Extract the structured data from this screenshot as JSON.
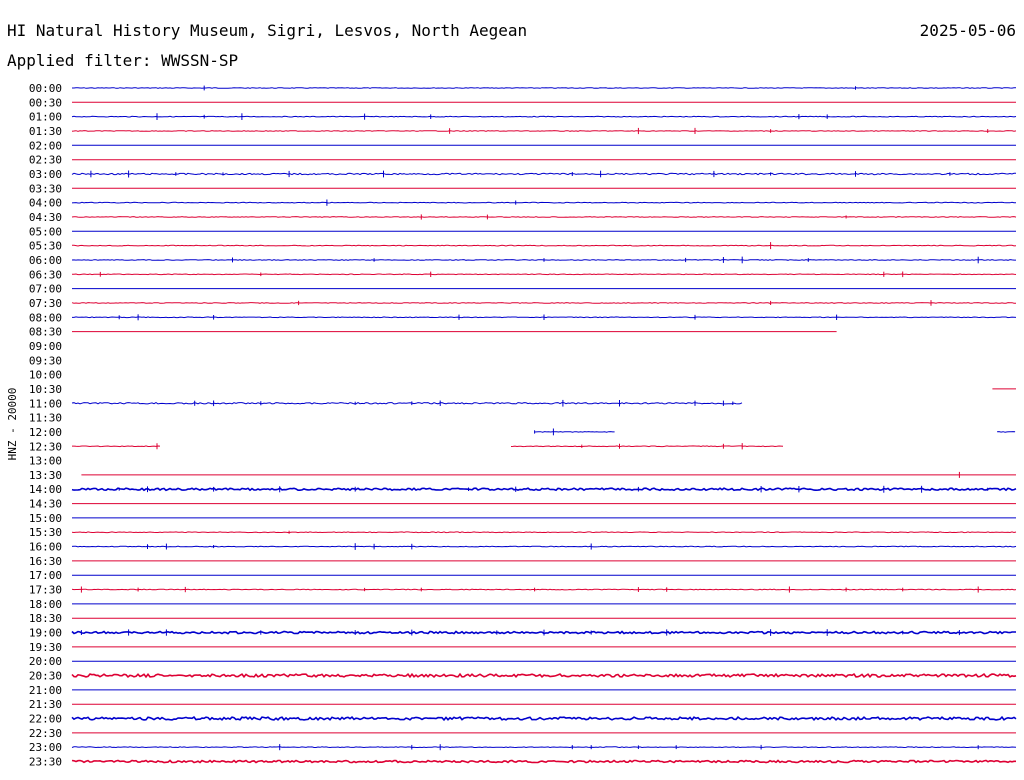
{
  "header": {
    "station": "HI Natural History Museum, Sigri, Lesvos, North Aegean",
    "date": "2025-05-06",
    "filter": "Applied filter: WWSSN-SP"
  },
  "colors": {
    "even_hour": "#0000cc",
    "half_hour": "#dd0033",
    "text": "#000000"
  },
  "chart_data": {
    "type": "line",
    "title": "HI Natural History Museum, Sigri, Lesvos, North Aegean",
    "subtitle": "Applied filter: WWSSN-SP",
    "ylabel": "HNZ - 20000",
    "xlim": [
      0,
      1
    ],
    "grid": false,
    "rows": [
      {
        "label": "00:00",
        "start": 0.0,
        "end": 1.0,
        "noise": 1,
        "spikes": [
          0.14,
          0.83
        ]
      },
      {
        "label": "00:30",
        "start": 0.0,
        "end": 1.0,
        "noise": 0,
        "spikes": []
      },
      {
        "label": "01:00",
        "start": 0.0,
        "end": 1.0,
        "noise": 1,
        "spikes": [
          0.09,
          0.14,
          0.18,
          0.31,
          0.38,
          0.77,
          0.8
        ]
      },
      {
        "label": "01:30",
        "start": 0.0,
        "end": 1.0,
        "noise": 1,
        "spikes": [
          0.4,
          0.6,
          0.66,
          0.74,
          0.97
        ]
      },
      {
        "label": "02:00",
        "start": 0.0,
        "end": 1.0,
        "noise": 0,
        "spikes": []
      },
      {
        "label": "02:30",
        "start": 0.0,
        "end": 1.0,
        "noise": 0,
        "spikes": []
      },
      {
        "label": "03:00",
        "start": 0.0,
        "end": 1.0,
        "noise": 2,
        "spikes": [
          0.02,
          0.06,
          0.11,
          0.16,
          0.23,
          0.33,
          0.53,
          0.56,
          0.68,
          0.74,
          0.83,
          0.93
        ]
      },
      {
        "label": "03:30",
        "start": 0.0,
        "end": 1.0,
        "noise": 0,
        "spikes": []
      },
      {
        "label": "04:00",
        "start": 0.0,
        "end": 1.0,
        "noise": 1,
        "spikes": [
          0.27,
          0.47
        ]
      },
      {
        "label": "04:30",
        "start": 0.0,
        "end": 1.0,
        "noise": 1,
        "spikes": [
          0.37,
          0.44,
          0.82
        ]
      },
      {
        "label": "05:00",
        "start": 0.0,
        "end": 1.0,
        "noise": 0,
        "spikes": []
      },
      {
        "label": "05:30",
        "start": 0.0,
        "end": 1.0,
        "noise": 1,
        "spikes": [
          0.74
        ]
      },
      {
        "label": "06:00",
        "start": 0.0,
        "end": 1.0,
        "noise": 1,
        "spikes": [
          0.17,
          0.32,
          0.5,
          0.65,
          0.69,
          0.71,
          0.78,
          0.96
        ]
      },
      {
        "label": "06:30",
        "start": 0.0,
        "end": 1.0,
        "noise": 1,
        "spikes": [
          0.03,
          0.2,
          0.38,
          0.86,
          0.88
        ]
      },
      {
        "label": "07:00",
        "start": 0.0,
        "end": 1.0,
        "noise": 0,
        "spikes": []
      },
      {
        "label": "07:30",
        "start": 0.0,
        "end": 1.0,
        "noise": 1,
        "spikes": [
          0.24,
          0.74,
          0.91
        ]
      },
      {
        "label": "08:00",
        "start": 0.0,
        "end": 1.0,
        "noise": 1,
        "spikes": [
          0.05,
          0.07,
          0.15,
          0.41,
          0.5,
          0.66,
          0.81
        ]
      },
      {
        "label": "08:30",
        "start": 0.0,
        "end": 0.81,
        "noise": 0,
        "spikes": []
      },
      {
        "label": "09:00",
        "segments": []
      },
      {
        "label": "09:30",
        "segments": []
      },
      {
        "label": "10:00",
        "segments": []
      },
      {
        "label": "10:30",
        "segments": [
          [
            0.975,
            1.0
          ]
        ],
        "noise": 0,
        "spikes": []
      },
      {
        "label": "11:00",
        "start": 0.0,
        "end": 0.71,
        "noise": 2,
        "spikes": [
          0.13,
          0.15,
          0.2,
          0.3,
          0.36,
          0.39,
          0.52,
          0.58,
          0.66,
          0.69,
          0.7
        ]
      },
      {
        "label": "11:30",
        "segments": []
      },
      {
        "label": "12:00",
        "segments": [
          [
            0.49,
            0.575
          ],
          [
            0.98,
            1.0
          ]
        ],
        "noise": 1,
        "spikes": [
          0.49,
          0.51
        ]
      },
      {
        "label": "12:30",
        "segments": [
          [
            0.0,
            0.095
          ],
          [
            0.465,
            0.755
          ]
        ],
        "noise": 1,
        "spikes": [
          0.09,
          0.54,
          0.58,
          0.69,
          0.71
        ]
      },
      {
        "label": "13:00",
        "segments": []
      },
      {
        "label": "13:30",
        "start": 0.01,
        "end": 1.0,
        "noise": 0,
        "spikes": [
          0.94
        ]
      },
      {
        "label": "14:00",
        "start": 0.0,
        "end": 1.0,
        "noise": 3,
        "spikes": [
          0.05,
          0.08,
          0.15,
          0.22,
          0.3,
          0.42,
          0.47,
          0.6,
          0.73,
          0.77,
          0.86,
          0.9,
          0.97
        ]
      },
      {
        "label": "14:30",
        "start": 0.0,
        "end": 1.0,
        "noise": 0,
        "spikes": []
      },
      {
        "label": "15:00",
        "start": 0.0,
        "end": 1.0,
        "noise": 0,
        "spikes": []
      },
      {
        "label": "15:30",
        "start": 0.0,
        "end": 1.0,
        "noise": 1,
        "spikes": [
          0.23
        ]
      },
      {
        "label": "16:00",
        "start": 0.0,
        "end": 1.0,
        "noise": 1,
        "spikes": [
          0.08,
          0.1,
          0.15,
          0.3,
          0.32,
          0.36,
          0.55
        ]
      },
      {
        "label": "16:30",
        "start": 0.0,
        "end": 1.0,
        "noise": 0,
        "spikes": []
      },
      {
        "label": "17:00",
        "start": 0.0,
        "end": 1.0,
        "noise": 0,
        "spikes": []
      },
      {
        "label": "17:30",
        "start": 0.0,
        "end": 1.0,
        "noise": 1,
        "spikes": [
          0.01,
          0.07,
          0.12,
          0.31,
          0.37,
          0.49,
          0.6,
          0.63,
          0.76,
          0.82,
          0.88,
          0.96
        ]
      },
      {
        "label": "18:00",
        "start": 0.0,
        "end": 1.0,
        "noise": 0,
        "spikes": []
      },
      {
        "label": "18:30",
        "start": 0.0,
        "end": 1.0,
        "noise": 0,
        "spikes": []
      },
      {
        "label": "19:00",
        "start": 0.0,
        "end": 1.0,
        "noise": 3,
        "spikes": [
          0.01,
          0.06,
          0.1,
          0.2,
          0.3,
          0.36,
          0.45,
          0.5,
          0.55,
          0.63,
          0.74,
          0.8,
          0.88,
          0.94
        ]
      },
      {
        "label": "19:30",
        "start": 0.0,
        "end": 1.0,
        "noise": 0,
        "spikes": []
      },
      {
        "label": "20:00",
        "start": 0.0,
        "end": 1.0,
        "noise": 0,
        "spikes": []
      },
      {
        "label": "20:30",
        "start": 0.0,
        "end": 1.0,
        "noise": 4,
        "spikes": []
      },
      {
        "label": "21:00",
        "start": 0.0,
        "end": 1.0,
        "noise": 0,
        "spikes": []
      },
      {
        "label": "21:30",
        "start": 0.0,
        "end": 1.0,
        "noise": 0,
        "spikes": []
      },
      {
        "label": "22:00",
        "start": 0.0,
        "end": 1.0,
        "noise": 4,
        "spikes": []
      },
      {
        "label": "22:30",
        "start": 0.0,
        "end": 1.0,
        "noise": 0,
        "spikes": []
      },
      {
        "label": "23:00",
        "start": 0.0,
        "end": 1.0,
        "noise": 1,
        "spikes": [
          0.22,
          0.36,
          0.39,
          0.53,
          0.55,
          0.6,
          0.64,
          0.73,
          0.96
        ]
      },
      {
        "label": "23:30",
        "start": 0.0,
        "end": 1.0,
        "noise": 3,
        "spikes": []
      }
    ]
  }
}
